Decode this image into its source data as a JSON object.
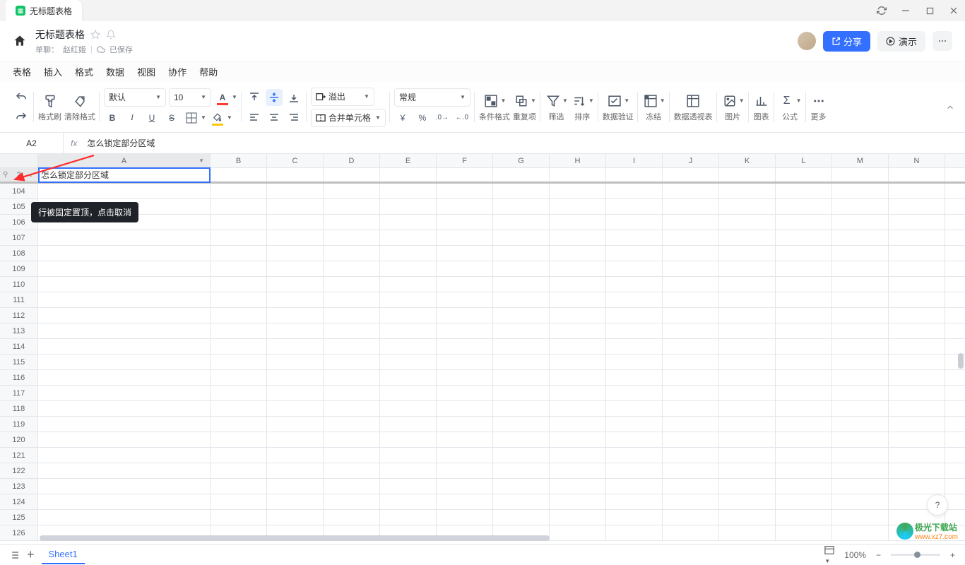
{
  "tab": {
    "title": "无标题表格"
  },
  "header": {
    "title": "无标题表格",
    "subtitle_prefix": "单聊：",
    "subtitle_user": "赵红姬",
    "saved_label": "已保存",
    "share_label": "分享",
    "demo_label": "演示"
  },
  "menu": [
    "表格",
    "插入",
    "格式",
    "数据",
    "视图",
    "协作",
    "帮助"
  ],
  "toolbar": {
    "paint_label": "格式刷",
    "clear_label": "清除格式",
    "font_name": "默认",
    "font_size": "10",
    "overflow_label": "溢出",
    "merge_label": "合并单元格",
    "number_format": "常规",
    "cond_format": "条件格式",
    "dup_label": "重复项",
    "filter_label": "筛选",
    "sort_label": "排序",
    "validate_label": "数据验证",
    "freeze_label": "冻结",
    "pivot_label": "数据透视表",
    "image_label": "图片",
    "chart_label": "图表",
    "formula_label": "公式",
    "more_label": "更多"
  },
  "formula": {
    "cell_ref": "A2",
    "fx": "fx",
    "value": "怎么锁定部分区域"
  },
  "grid": {
    "columns": [
      "A",
      "B",
      "C",
      "D",
      "E",
      "F",
      "G",
      "H",
      "I",
      "J",
      "K",
      "L",
      "M",
      "N"
    ],
    "frozen_row_num": "2",
    "frozen_cell_A": "怎么锁定部分区域",
    "row_labels": [
      "104",
      "105",
      "106",
      "107",
      "108",
      "109",
      "110",
      "111",
      "112",
      "113",
      "114",
      "115",
      "116",
      "117",
      "118",
      "119",
      "120",
      "121",
      "122",
      "123",
      "124",
      "125",
      "126"
    ],
    "tooltip": "行被固定置顶，点击取消"
  },
  "sheet": {
    "name": "Sheet1"
  },
  "status": {
    "zoom": "100%"
  },
  "watermark": {
    "text": "极光下载站",
    "url": "www.xz7.com"
  }
}
